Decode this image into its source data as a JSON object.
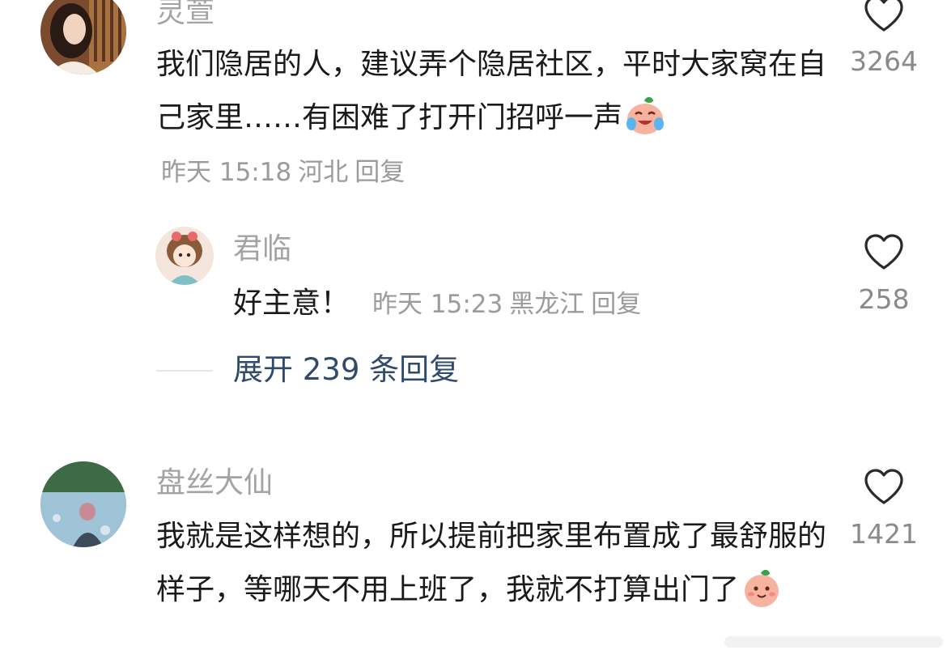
{
  "comments": [
    {
      "username": "灵萱",
      "content": "我们隐居的人，建议弄个隐居社区，平时大家窝在自己家里……有困难了打开门招呼一声",
      "emoji": "laughing-crying-face-emoji",
      "time": "昨天 15:18",
      "location": "河北",
      "reply_label": "回复",
      "likes": "3264"
    },
    {
      "username": "君临",
      "content": "好主意！",
      "time": "昨天 15:23",
      "location": "黑龙江",
      "reply_label": "回复",
      "likes": "258"
    },
    {
      "username": "盘丝大仙",
      "content": "我就是这样想的，所以提前把家里布置成了最舒服的样子，等哪天不用上班了，我就不打算出门了",
      "emoji": "smiling-peach-emoji",
      "likes": "1421"
    }
  ],
  "expand_replies": "展开 239 条回复",
  "icons": {
    "like": "heart-outline-icon"
  },
  "colors": {
    "username": "#a3a3a3",
    "meta": "#9b9b9b",
    "link": "#2f4a6b",
    "text": "#1a1a1a"
  }
}
